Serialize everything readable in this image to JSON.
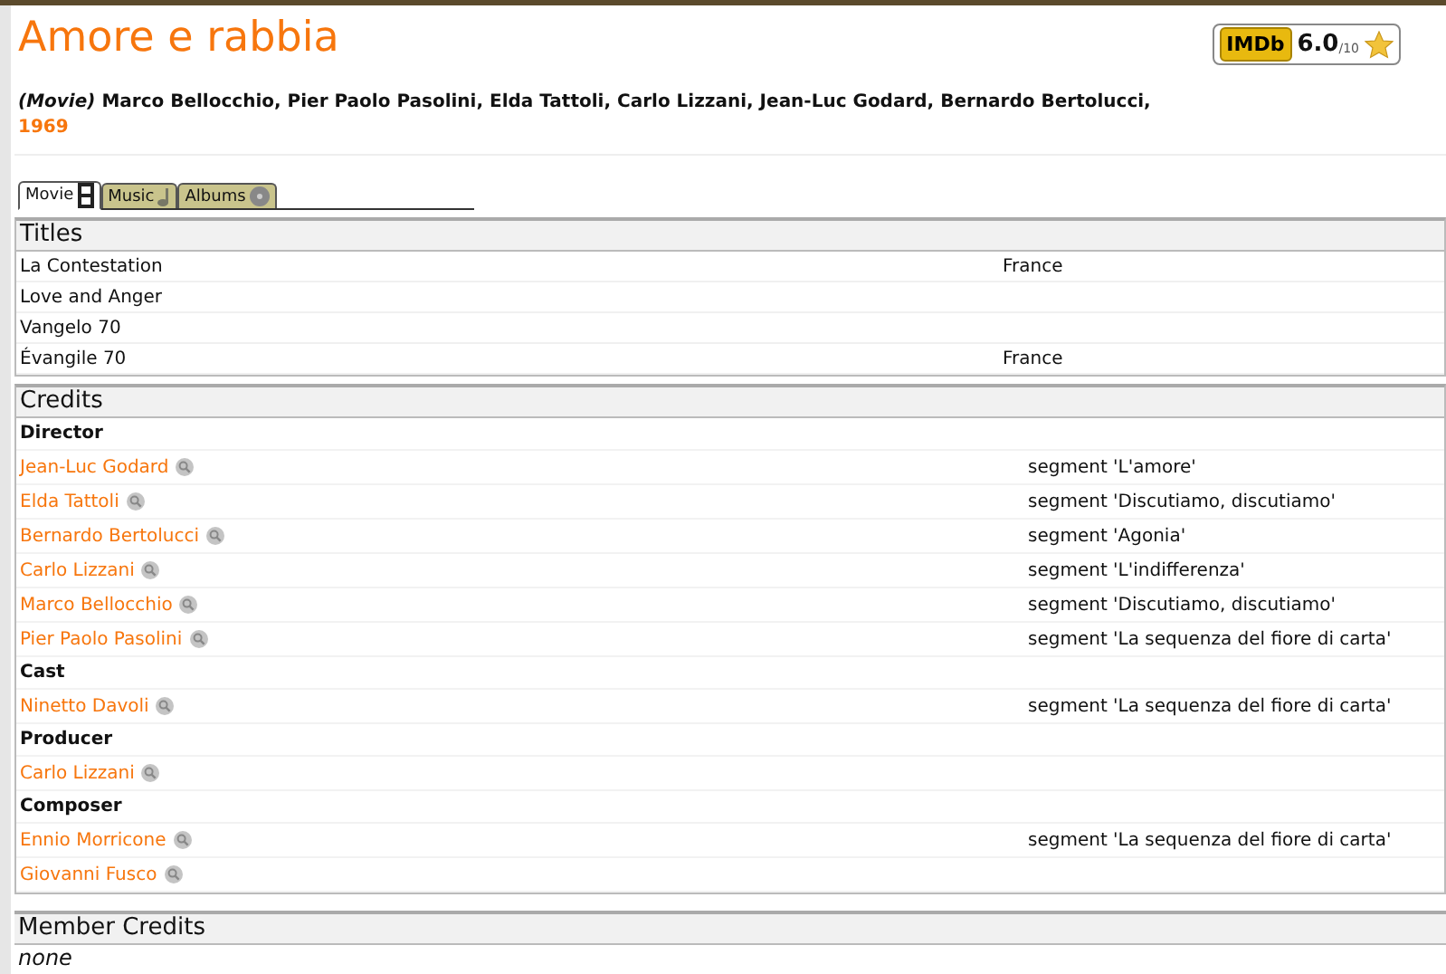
{
  "title": "Amore e rabbia",
  "rating": {
    "logo": "IMDb",
    "score": "6.0",
    "scale": "/10"
  },
  "byline": {
    "kind_label": "(Movie)",
    "people": "Marco Bellocchio, Pier Paolo Pasolini, Elda Tattoli, Carlo Lizzani, Jean-Luc Godard, Bernardo Bertolucci,",
    "year": "1969"
  },
  "tabs": [
    {
      "label": "Movie",
      "kind": "film",
      "selected": true
    },
    {
      "label": "Music",
      "kind": "music",
      "selected": false
    },
    {
      "label": "Albums",
      "kind": "albums",
      "selected": false
    }
  ],
  "titles": {
    "heading": "Titles",
    "rows": [
      {
        "title": "La Contestation",
        "country": "France"
      },
      {
        "title": "Love and Anger"
      },
      {
        "title": "Vangelo 70"
      },
      {
        "title": "Évangile 70",
        "country": "France"
      }
    ]
  },
  "credits": {
    "heading": "Credits",
    "rows": [
      {
        "kind": "role",
        "label": "Director"
      },
      {
        "kind": "person",
        "name": "Jean-Luc Godard",
        "note": "segment 'L'amore'"
      },
      {
        "kind": "person",
        "name": "Elda Tattoli",
        "note": "segment 'Discutiamo, discutiamo'"
      },
      {
        "kind": "person",
        "name": "Bernardo Bertolucci",
        "note": "segment 'Agonia'"
      },
      {
        "kind": "person",
        "name": "Carlo Lizzani",
        "note": "segment 'L'indifferenza'"
      },
      {
        "kind": "person",
        "name": "Marco Bellocchio",
        "note": "segment 'Discutiamo, discutiamo'"
      },
      {
        "kind": "person",
        "name": "Pier Paolo Pasolini",
        "note": "segment 'La sequenza del fiore di carta'"
      },
      {
        "kind": "role",
        "label": "Cast"
      },
      {
        "kind": "person",
        "name": "Ninetto Davoli",
        "note": "segment 'La sequenza del fiore di carta'"
      },
      {
        "kind": "role",
        "label": "Producer"
      },
      {
        "kind": "person",
        "name": "Carlo Lizzani"
      },
      {
        "kind": "role",
        "label": "Composer"
      },
      {
        "kind": "person",
        "name": "Ennio Morricone",
        "note": "segment 'La sequenza del fiore di carta'"
      },
      {
        "kind": "person",
        "name": "Giovanni Fusco"
      }
    ]
  },
  "member_credits": {
    "heading": "Member Credits",
    "value": "none"
  }
}
